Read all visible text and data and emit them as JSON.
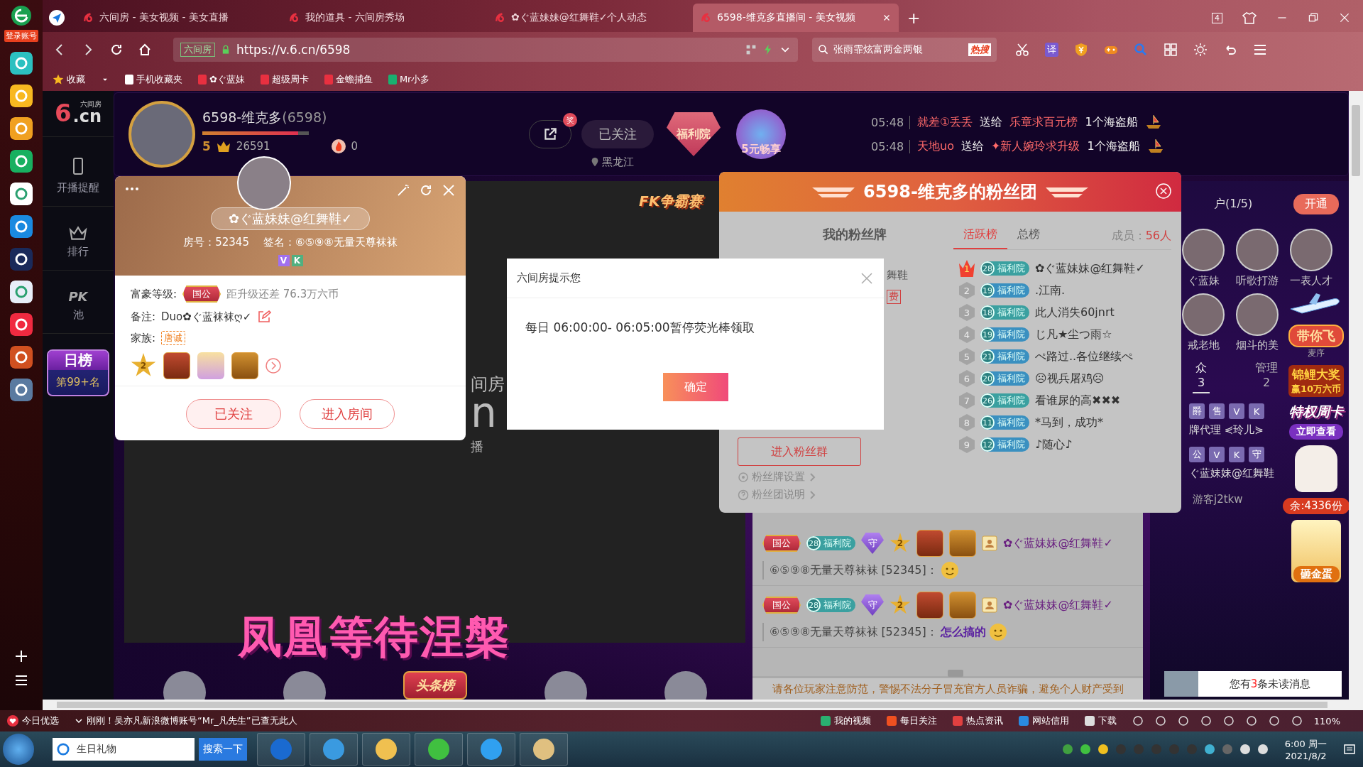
{
  "browser": {
    "tabs": [
      {
        "title": "六间房 - 美女视频 - 美女直播",
        "selected": false
      },
      {
        "title": "我的道具 - 六间房秀场",
        "selected": false
      },
      {
        "title": "✿ぐ蓝妹妹@红舞鞋✓个人动态",
        "selected": false
      },
      {
        "title": "6598-维克多直播间 - 美女视频",
        "selected": true
      }
    ],
    "new_tab": "+",
    "window_count": "4",
    "address": {
      "site_label": "六间房",
      "url": "https://v.6.cn/6598"
    },
    "search": {
      "value": "张雨霏炫富两金两银",
      "hot_tag": "热搜"
    },
    "translate": "译",
    "bookmarks": [
      "收藏",
      "手机收藏夹",
      "✿ぐ蓝妹",
      "超级周卡",
      "金蟾捕鱼",
      "Mr小多"
    ]
  },
  "side_strip": {
    "login": "登录账号"
  },
  "nav": {
    "logo_cn": "六间房",
    "logo_mark": "6",
    "logo": ".cn",
    "items": [
      "开播提醒",
      "排行"
    ],
    "pk": "PK",
    "pk_sub": "池",
    "daily_rank": {
      "title": "日榜",
      "rank": "第99+名"
    }
  },
  "anchor": {
    "name": "6598-维克多",
    "id": "(6598)",
    "level": 0.9,
    "level_num": "5",
    "coins": "26591",
    "fire": "0",
    "follow": "已关注",
    "reward_badge": "奖",
    "location": "黑龙江",
    "welfare": "福利院",
    "promo": "5元畅享"
  },
  "gift_feed": [
    {
      "time": "05:48",
      "sender": "就差①丢丢",
      "verb": "送给",
      "receiver": "乐章求百元榜",
      "gift": "1个海盗船"
    },
    {
      "time": "05:48",
      "sender": "天地uo",
      "verb": "送给",
      "receiver": "✦新人婉玲求升级",
      "gift": "1个海盗船"
    }
  ],
  "video": {
    "banner": "FK争霸赛",
    "logo_parts": [
      "间房",
      "n",
      "播"
    ],
    "title": "凤凰等待涅槃",
    "headline": "头条榜"
  },
  "chat": {
    "messages": [
      {
        "header": {
          "rank": "国公",
          "fan_level": "28",
          "fan_club": "福利院",
          "guard": "守",
          "star": "2",
          "name": "✿ぐ蓝妹妹@红舞鞋✓"
        },
        "author": "⑥⑤⑨⑧无量天尊袜袜",
        "room": "[52345]："
      },
      {
        "header": {
          "rank": "国公",
          "fan_level": "28",
          "fan_club": "福利院",
          "guard": "守",
          "star": "2",
          "name": "✿ぐ蓝妹妹@红舞鞋✓"
        },
        "author": "⑥⑤⑨⑧无量天尊袜袜",
        "room": "[52345]：",
        "text": "怎么搞的"
      }
    ],
    "notice": "请各位玩家注意防范，警惕不法分子冒充官方人员诈骗，避免个人财产受到"
  },
  "side": {
    "guard_title": "户(1/5)",
    "open": "开通",
    "guards": [
      "ぐ蓝妹",
      "听歌打游",
      "一表人才",
      "戒老地",
      "烟斗的美"
    ],
    "tabs": [
      {
        "label": "众",
        "count": "3",
        "selected": true
      },
      {
        "label": "管理",
        "count": "2",
        "selected": false
      }
    ],
    "rows": [
      {
        "badges": [
          "爵",
          "售",
          "V",
          "K"
        ],
        "name": "牌代理 ⋞玲儿⋟"
      },
      {
        "badges": [
          "公",
          "V",
          "K",
          "守"
        ],
        "name": "ぐ蓝妹妹@红舞鞋"
      }
    ],
    "guest": "游客j2tkw",
    "promos": {
      "fly": "带你飞",
      "mic": "麦序",
      "koi": "锦鲤大奖",
      "koi_sub": "赢10万六币",
      "card": "特权周卡",
      "card_button": "立即查看",
      "remain": "余:4336份",
      "egg": "砸金蛋"
    },
    "unread": {
      "prefix": "您有",
      "count": "3",
      "suffix": "条未读消息"
    }
  },
  "user_card": {
    "name": "✿ぐ蓝妹妹@红舞鞋✓",
    "room": "房号：52345",
    "signature": "签名：⑥⑤⑨⑧无量天尊袜袜",
    "tags": [
      "V",
      "K"
    ],
    "wealth_label": "富豪等级:",
    "wealth_rank": "国公",
    "upgrade": "距升级还差 76.3万六币",
    "note_label": "备注:",
    "note": "Duo✿ぐ蓝袜袜ღ✓",
    "family_label": "家族:",
    "family": "唐诚",
    "star_level": "2",
    "buttons": [
      {
        "label": "已关注",
        "kind": "followed"
      },
      {
        "label": "进入房间",
        "kind": "enter"
      }
    ]
  },
  "dialog": {
    "title": "六间房提示您",
    "message": "每日 06:00:00- 06:05:00暂停荧光棒领取",
    "confirm": "确定"
  },
  "fan_club": {
    "title": "6598-维克多的粉丝团",
    "my_badge": "我的粉丝牌",
    "peek_name": "舞鞋",
    "peek_button": "费",
    "tabs": [
      {
        "label": "活跃榜",
        "selected": true
      },
      {
        "label": "总榜",
        "selected": false
      }
    ],
    "members_label": "成员：",
    "members": "56人",
    "ranking": [
      {
        "rank": "1",
        "level": "28",
        "club": "福利院",
        "name": "✿ぐ蓝妹妹@红舞鞋✓"
      },
      {
        "rank": "2",
        "level": "19",
        "club": "福利院",
        "name": ".江南."
      },
      {
        "rank": "3",
        "level": "18",
        "club": "福利院",
        "name": "此人消失60jnrt"
      },
      {
        "rank": "4",
        "level": "19",
        "club": "福利院",
        "name": "じ凡★尘つ雨☆"
      },
      {
        "rank": "5",
        "level": "21",
        "club": "福利院",
        "name": "ぺ路过..各位继续ぺ"
      },
      {
        "rank": "6",
        "level": "20",
        "club": "福利院",
        "name": "☹视兵屠鸡☹"
      },
      {
        "rank": "7",
        "level": "26",
        "club": "福利院",
        "name": "看谁尿的高✖✖✖"
      },
      {
        "rank": "8",
        "level": "11",
        "club": "福利院",
        "name": "*马到，成功*"
      },
      {
        "rank": "9",
        "level": "12",
        "club": "福利院",
        "name": "♪随心♪"
      }
    ],
    "join": "进入粉丝群",
    "links": [
      "粉丝牌设置",
      "粉丝团说明"
    ]
  },
  "status_bar": {
    "today": "今日优选",
    "news": "刚刚！吴亦凡新浪微博账号“Mr_凡先生”已查无此人",
    "links": [
      "我的视频",
      "每日关注",
      "热点资讯",
      "网站信用",
      "下载"
    ],
    "zoom": "110%"
  },
  "taskbar": {
    "search": "生日礼物",
    "search_button": "搜索一下",
    "time": "6:00 周一",
    "date": "2021/8/2"
  }
}
